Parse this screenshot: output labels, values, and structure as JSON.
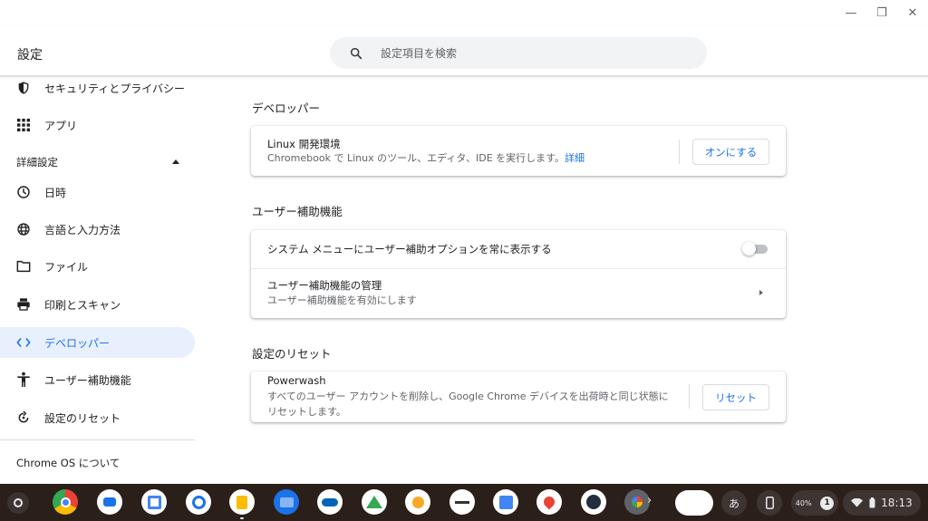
{
  "window": {
    "minimize": "—",
    "maximize": "❐",
    "close": "✕"
  },
  "header": {
    "title": "設定",
    "search_placeholder": "設定項目を検索"
  },
  "sidebar": {
    "items_top": [
      {
        "label": "セキュリティとプライバシー",
        "icon": "shield-icon"
      },
      {
        "label": "アプリ",
        "icon": "apps-grid-icon"
      }
    ],
    "advanced_label": "詳細設定",
    "items_advanced": [
      {
        "label": "日時",
        "icon": "clock-icon"
      },
      {
        "label": "言語と入力方法",
        "icon": "globe-icon"
      },
      {
        "label": "ファイル",
        "icon": "folder-icon"
      },
      {
        "label": "印刷とスキャン",
        "icon": "printer-icon"
      },
      {
        "label": "デベロッパー",
        "icon": "code-icon"
      },
      {
        "label": "ユーザー補助機能",
        "icon": "accessibility-icon"
      },
      {
        "label": "設定のリセット",
        "icon": "reset-icon"
      }
    ],
    "about_label": "Chrome OS について"
  },
  "main": {
    "developer": {
      "title": "デベロッパー",
      "linux_title": "Linux 開発環境",
      "linux_sub": "Chromebook で Linux のツール、エディタ、IDE を実行します。",
      "linux_link": "詳細",
      "linux_button": "オンにする"
    },
    "accessibility": {
      "title": "ユーザー補助機能",
      "show_menu_label": "システム メニューにユーザー補助オプションを常に表示する",
      "manage_title": "ユーザー補助機能の管理",
      "manage_sub": "ユーザー補助機能を有効にします"
    },
    "reset": {
      "title": "設定のリセット",
      "powerwash_title": "Powerwash",
      "powerwash_sub_1": "すべてのユーザー アカウントを削除し、Google Chrome デバイスを出荷時と同じ状態に",
      "powerwash_sub_2": "リセットします。",
      "reset_button": "リセット"
    }
  },
  "shelf": {
    "apps": [
      {
        "name": "chrome-app-icon",
        "color": "#ea4335"
      },
      {
        "name": "camera-app-icon",
        "color": "#ffffff"
      },
      {
        "name": "calendar-app-icon",
        "color": "#ffffff"
      },
      {
        "name": "tasks-app-icon",
        "color": "#ffffff"
      },
      {
        "name": "keep-app-icon",
        "color": "#ffffff"
      },
      {
        "name": "files-app-icon",
        "color": "#1a73e8"
      },
      {
        "name": "onedrive-app-icon",
        "color": "#ffffff"
      },
      {
        "name": "drive-app-icon",
        "color": "#ffffff"
      },
      {
        "name": "weather-app-icon",
        "color": "#ffffff"
      },
      {
        "name": "news-app-icon",
        "color": "#ffffff"
      },
      {
        "name": "docs-app-icon",
        "color": "#ffffff"
      },
      {
        "name": "maps-app-icon",
        "color": "#ffffff"
      },
      {
        "name": "kindle-app-icon",
        "color": "#ffffff"
      },
      {
        "name": "photos-app-icon",
        "color": "#5f6368"
      }
    ],
    "ime": "あ",
    "battery_percent": "40%",
    "notification_count": "1",
    "time": "18:13"
  },
  "colors": {
    "accent": "#1a73e8",
    "active_bg": "#e8f0fe",
    "shelf_bg": "#2b1f1a"
  }
}
